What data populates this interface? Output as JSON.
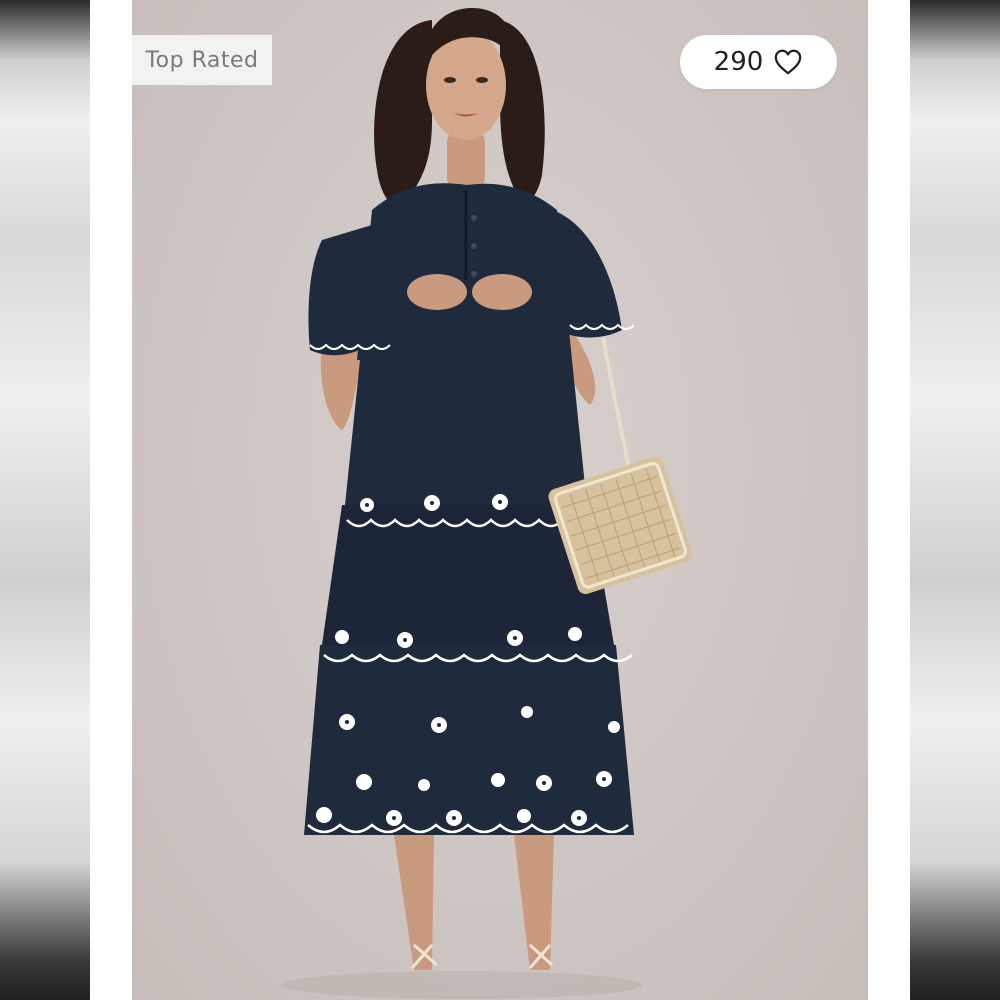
{
  "listing": {
    "badge": "Top Rated",
    "likes": {
      "count": "290",
      "icon": "heart-outline-icon"
    },
    "image": {
      "subject": "model-wearing-navy-tiered-dress",
      "accessory": "woven-cane-shoulder-bag"
    }
  },
  "colors": {
    "background": "#cec6c3",
    "dress": "#1f2a3c",
    "embroidery": "#ffffff",
    "bag": "#d8c29e",
    "badge_bg": "#f2f2f1",
    "badge_text": "#7a7a7a"
  }
}
